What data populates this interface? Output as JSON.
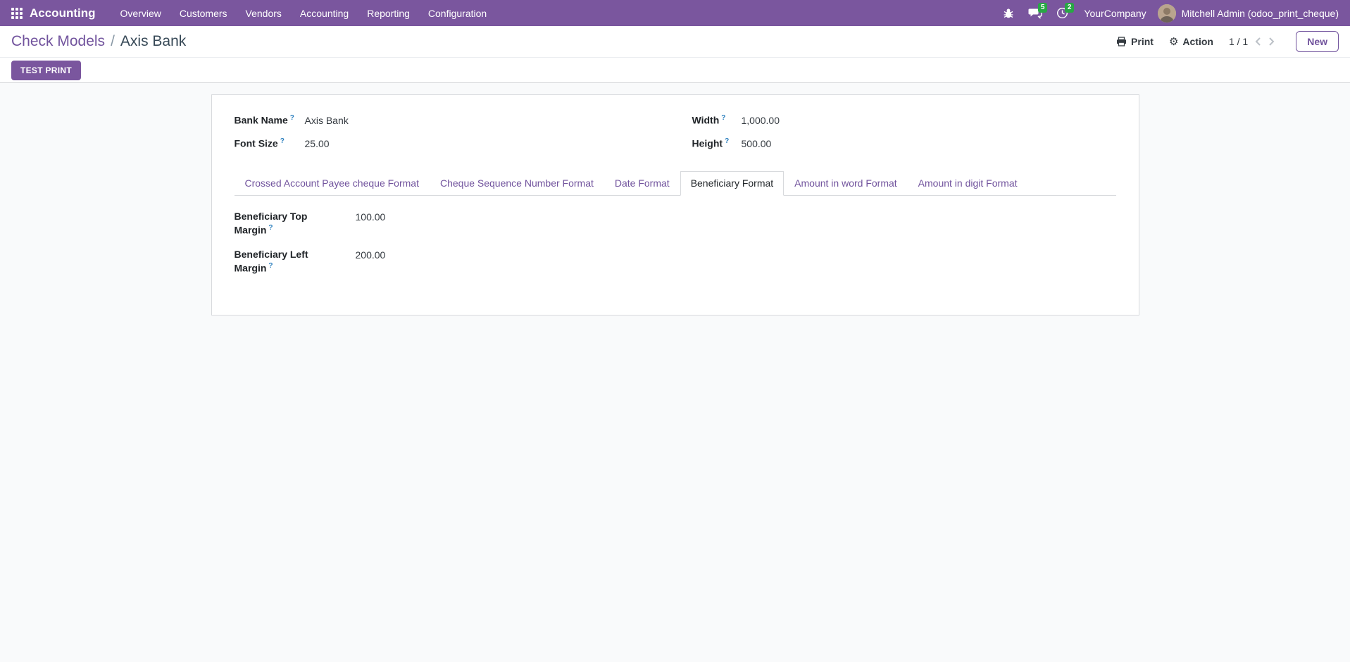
{
  "colors": {
    "header-bg": "#7a569e",
    "accent-purple": "#71539d",
    "badge-green": "#28a745",
    "help-blue": "#2b7fbe",
    "text-dark": "#212529",
    "border": "#d8dadd",
    "body-bg": "#f9fafb",
    "crumb-current": "#374957"
  },
  "navbar": {
    "app_name": "Accounting",
    "menu": [
      "Overview",
      "Customers",
      "Vendors",
      "Accounting",
      "Reporting",
      "Configuration"
    ],
    "message_count": "5",
    "activity_count": "2",
    "company": "YourCompany",
    "user": "Mitchell Admin (odoo_print_cheque)"
  },
  "breadcrumb": {
    "parent": "Check Models",
    "separator": "/",
    "current": "Axis Bank"
  },
  "control_panel": {
    "print_label": "Print",
    "action_label": "Action",
    "gear_glyph": "⚙",
    "pager": "1 / 1",
    "new_label": "New"
  },
  "statusbar": {
    "test_print_label": "TEST PRINT"
  },
  "form": {
    "help_marker": "?",
    "fields": {
      "bank_name": {
        "label": "Bank Name",
        "value": "Axis Bank"
      },
      "font_size": {
        "label": "Font Size",
        "value": "25.00"
      },
      "width": {
        "label": "Width",
        "value": "1,000.00"
      },
      "height": {
        "label": "Height",
        "value": "500.00"
      }
    },
    "tabs": [
      {
        "label": "Crossed Account Payee cheque Format",
        "active": false
      },
      {
        "label": "Cheque Sequence Number Format",
        "active": false
      },
      {
        "label": "Date Format",
        "active": false
      },
      {
        "label": "Beneficiary Format",
        "active": true
      },
      {
        "label": "Amount in word Format",
        "active": false
      },
      {
        "label": "Amount in digit Format",
        "active": false
      }
    ],
    "tab_content": {
      "beneficiary_top_margin": {
        "label": "Beneficiary Top Margin",
        "value": "100.00"
      },
      "beneficiary_left_margin": {
        "label": "Beneficiary Left Margin",
        "value": "200.00"
      }
    }
  }
}
